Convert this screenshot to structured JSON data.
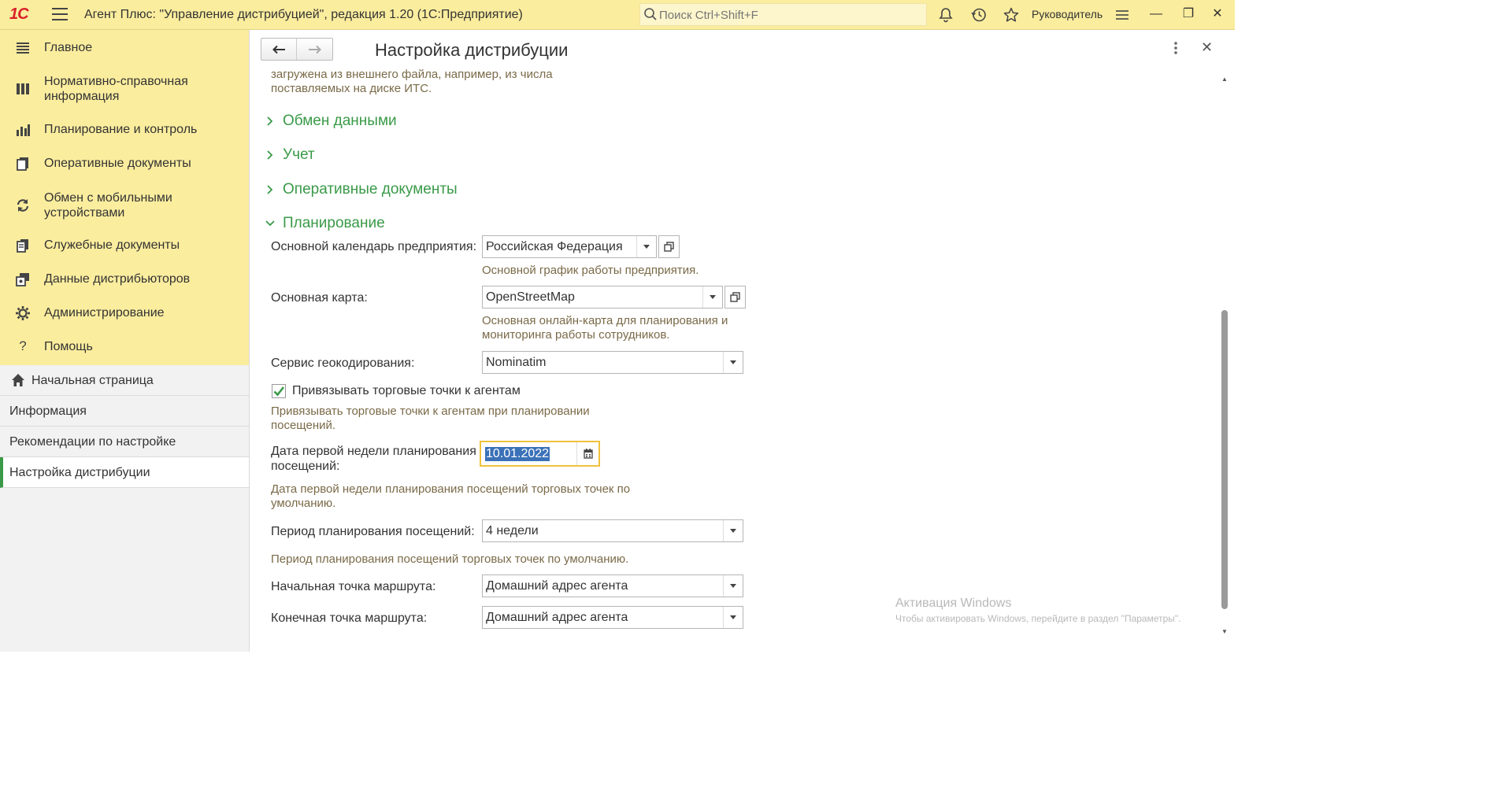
{
  "topbar": {
    "logo": "1С",
    "title": "Агент Плюс: \"Управление дистрибуцией\", редакция 1.20  (1С:Предприятие)",
    "search_placeholder": "Поиск Ctrl+Shift+F",
    "user": "Руководитель",
    "icons": [
      "bell-icon",
      "history-icon",
      "star-icon",
      "settings-lines-icon"
    ],
    "window_buttons": [
      "minimize",
      "restore",
      "close"
    ]
  },
  "sidebar": {
    "items": [
      {
        "label": "Главное",
        "icon": "menu-lines-icon"
      },
      {
        "label": "Нормативно-справочная информация",
        "icon": "catalog-icon"
      },
      {
        "label": "Планирование и контроль",
        "icon": "bar-chart-icon"
      },
      {
        "label": "Оперативные документы",
        "icon": "documents-icon"
      },
      {
        "label": "Обмен с мобильными устройствами",
        "icon": "sync-icon"
      },
      {
        "label": "Служебные документы",
        "icon": "service-docs-icon"
      },
      {
        "label": "Данные дистрибьюторов",
        "icon": "distributors-icon"
      },
      {
        "label": "Администрирование",
        "icon": "gear-icon"
      },
      {
        "label": "Помощь",
        "icon": "help-icon"
      }
    ],
    "open_windows": [
      {
        "label": "Начальная страница",
        "icon": "home-icon"
      },
      {
        "label": "Информация"
      },
      {
        "label": "Рекомендации по настройке"
      },
      {
        "label": "Настройка дистрибуции",
        "active": true
      }
    ]
  },
  "form": {
    "title": "Настройка дистрибуции",
    "intro_note": "загружена из внешнего файла, например, из числа поставляемых на диске ИТС.",
    "sections": [
      {
        "label": "Обмен данными",
        "expanded": false
      },
      {
        "label": "Учет",
        "expanded": false
      },
      {
        "label": "Оперативные документы",
        "expanded": false
      },
      {
        "label": "Планирование",
        "expanded": true
      }
    ],
    "calendar": {
      "label": "Основной календарь предприятия:",
      "value": "Российская Федерация",
      "hint": "Основной график работы предприятия."
    },
    "map": {
      "label": "Основная карта:",
      "value": "OpenStreetMap",
      "hint": "Основная онлайн-карта для планирования и мониторинга работы сотрудников."
    },
    "geocoding": {
      "label": "Сервис геокодирования:",
      "value": "Nominatim"
    },
    "bind_outlets": {
      "label": "Привязывать торговые точки к агентам",
      "checked": true,
      "hint": "Привязывать торговые точки к агентам при планировании посещений."
    },
    "first_week": {
      "label": "Дата первой недели планирования посещений:",
      "value": "10.01.2022",
      "hint": "Дата первой недели планирования посещений торговых точек по умолчанию."
    },
    "period": {
      "label": "Период планирования посещений:",
      "value": "4 недели",
      "hint": "Период планирования посещений торговых точек по умолчанию."
    },
    "route_start": {
      "label": "Начальная точка маршрута:",
      "value": "Домашний адрес агента"
    },
    "route_end": {
      "label": "Конечная точка маршрута:",
      "value": "Домашний адрес агента"
    }
  },
  "watermark": {
    "line1": "Активация Windows",
    "line2": "Чтобы активировать Windows, перейдите в раздел \"Параметры\"."
  },
  "colors": {
    "topbar_bg": "#fbed9e",
    "section_green": "#3a9a48",
    "hint_brown": "#7a6a48",
    "focus_yellow": "#f0c23c",
    "selection_blue": "#3b71b8"
  }
}
